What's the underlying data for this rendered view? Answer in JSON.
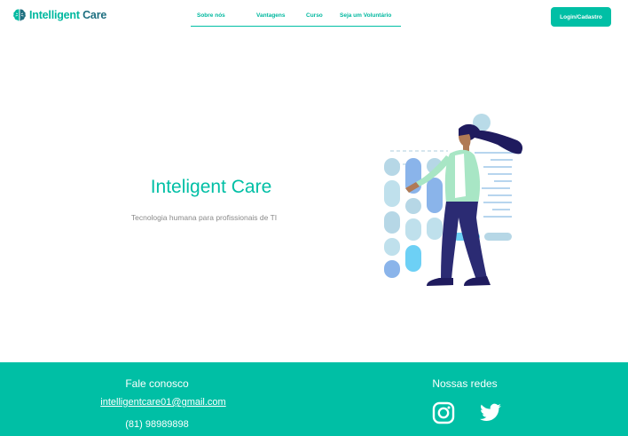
{
  "header": {
    "logo_icon": "brain-icon",
    "logo_word1": "Intelligent",
    "logo_word2": "Care",
    "nav": [
      {
        "label": "Sobre nós"
      },
      {
        "label": "Vantagens"
      },
      {
        "label": "Curso"
      },
      {
        "label": "Seja um Voluntário"
      }
    ],
    "login_label": "Login/Cadastro"
  },
  "hero": {
    "title": "Inteligent Care",
    "subtitle": "Tecnologia humana para profissionais de TI",
    "illustration": "woman-with-data-panel-illustration"
  },
  "footer": {
    "contact_heading": "Fale conosco",
    "email": "intelligentcare01@gmail.com",
    "phone": "(81) 98989898",
    "social_heading": "Nossas redes",
    "social": [
      {
        "name": "instagram-icon"
      },
      {
        "name": "twitter-icon"
      }
    ]
  },
  "colors": {
    "accent": "#00bfa5",
    "logo_dark": "#1e6f80",
    "text_muted": "#8a8a8a"
  }
}
